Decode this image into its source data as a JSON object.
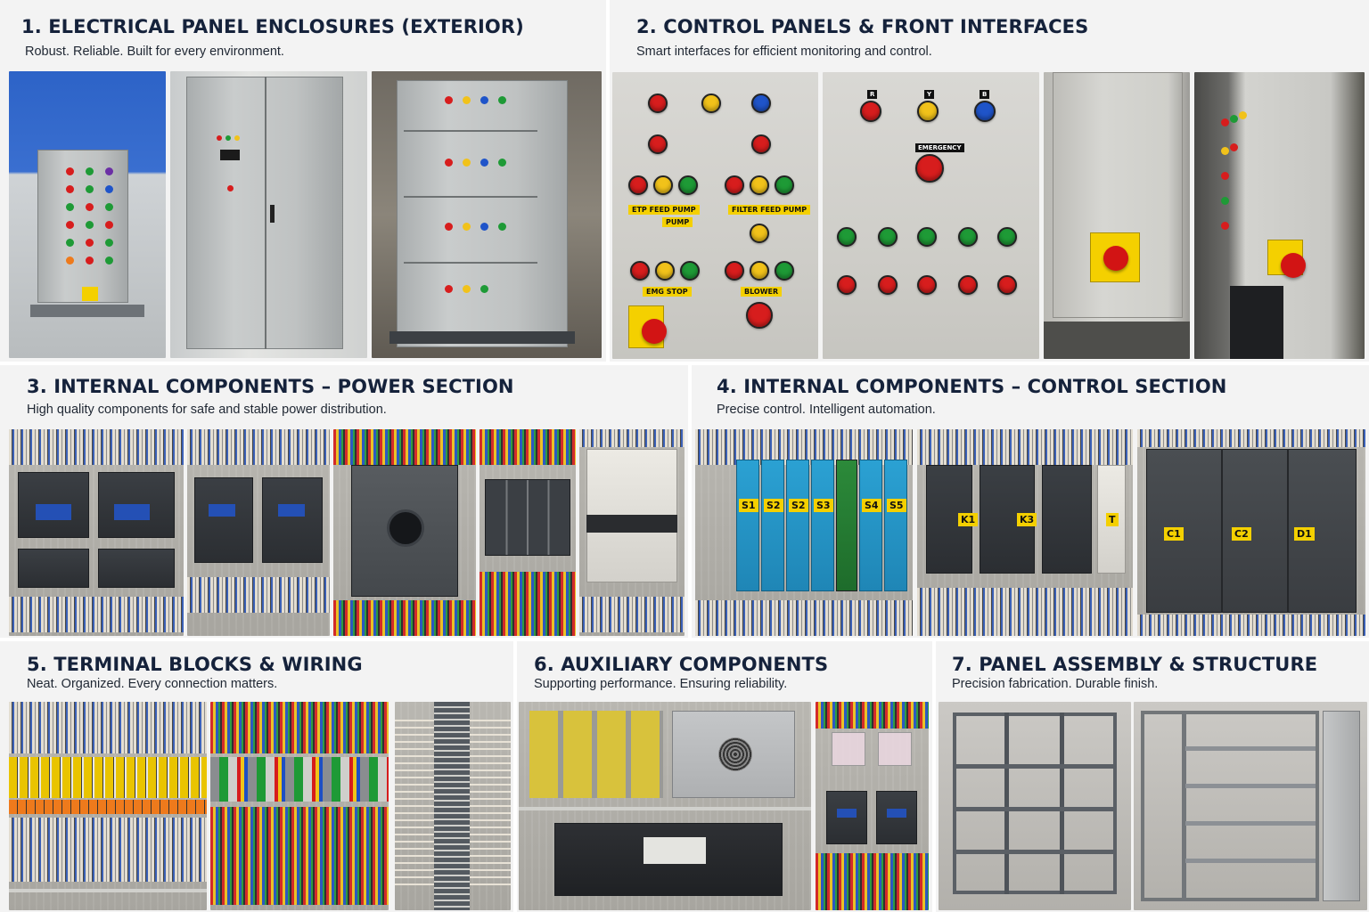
{
  "sections": [
    {
      "title": "1. ELECTRICAL PANEL ENCLOSURES (EXTERIOR)",
      "subtitle": "Robust. Reliable. Built for every environment."
    },
    {
      "title": "2. CONTROL PANELS & FRONT INTERFACES",
      "subtitle": "Smart interfaces for efficient monitoring and control."
    },
    {
      "title": "3. INTERNAL COMPONENTS – POWER SECTION",
      "subtitle": "High quality components for safe and stable power distribution."
    },
    {
      "title": "4. INTERNAL COMPONENTS – CONTROL SECTION",
      "subtitle": "Precise control. Intelligent automation."
    },
    {
      "title": "5. TERMINAL BLOCKS & WIRING",
      "subtitle": "Neat. Organized. Every connection matters."
    },
    {
      "title": "6. AUXILIARY COMPONENTS",
      "subtitle": "Supporting performance. Ensuring reliability."
    },
    {
      "title": "7. PANEL ASSEMBLY & STRUCTURE",
      "subtitle": "Precision fabrication. Durable finish."
    }
  ],
  "panel_labels": {
    "etp_feed_pump": "ETP FEED PUMP",
    "filter_feed_pump": "FILTER FEED PUMP",
    "pump": "PUMP",
    "emg_stop": "EMG STOP",
    "blower": "BLOWER",
    "emergency": "EMERGENCY",
    "r": "R",
    "y": "Y",
    "b": "B"
  },
  "component_labels": {
    "relays": [
      "S1",
      "S2",
      "S2",
      "S3",
      "S4",
      "S5"
    ],
    "contactors": [
      "K1",
      "K3",
      "T"
    ],
    "plc": [
      "C1",
      "C2",
      "D1"
    ]
  },
  "colors": {
    "title": "#15223b",
    "indicator_red": "#d71d1d",
    "indicator_green": "#1e9a36",
    "indicator_yellow": "#f1c21a",
    "indicator_blue": "#1f54c9",
    "label_yellow": "#f4d000"
  }
}
